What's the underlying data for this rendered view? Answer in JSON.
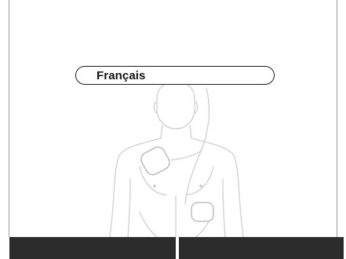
{
  "language_selector": {
    "label": "Français"
  },
  "softkeys": {
    "left_label": "",
    "right_label": ""
  },
  "illustration": {
    "subject": "torso-with-electrode-pads",
    "line_color": "#cfcfcf",
    "pad_color": "#bdbdbd"
  },
  "colors": {
    "background": "#ffffff",
    "softkey": "#2c2c2c",
    "pill_border": "#1e1e1e",
    "frame": "#9a9a9a"
  }
}
